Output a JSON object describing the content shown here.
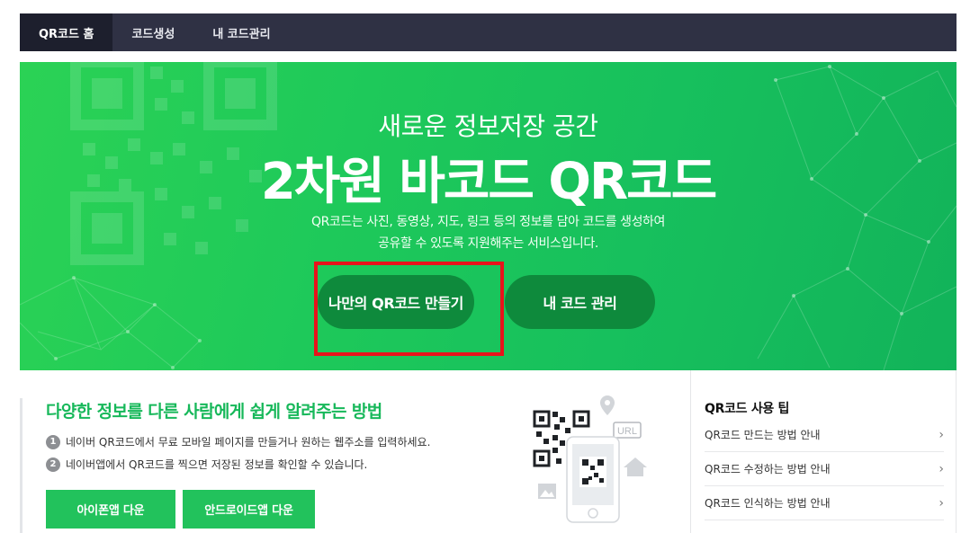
{
  "nav": {
    "tabs": [
      {
        "label": "QR코드 홈",
        "active": true
      },
      {
        "label": "코드생성",
        "active": false
      },
      {
        "label": "내 코드관리",
        "active": false
      }
    ]
  },
  "hero": {
    "subtitle": "새로운 정보저장 공간",
    "title": "2차원 바코드 QR코드",
    "desc_line1": "QR코드는 사진, 동영상, 지도, 링크 등의 정보를 담아 코드를 생성하여",
    "desc_line2": "공유할 수 있도록 지원해주는 서비스입니다.",
    "make_button": "나만의 QR코드 만들기",
    "manage_button": "내 코드 관리"
  },
  "info": {
    "title": "다양한 정보를 다른 사람에게 쉽게 알려주는 방법",
    "line1_num": "1",
    "line1": "네이버 QR코드에서 무료 모바일 페이지를 만들거나 원하는 웹주소를 입력하세요.",
    "line2_num": "2",
    "line2": "네이버앱에서 QR코드를 찍으면 저장된 정보를 확인할 수 있습니다.",
    "ios_button": "아이폰앱 다운",
    "android_button": "안드로이드앱 다운",
    "illust_url_label": "URL"
  },
  "tips": {
    "title": "QR코드 사용 팁",
    "items": [
      {
        "label": "QR코드 만드는 방법 안내",
        "chevron": "›"
      },
      {
        "label": "QR코드 수정하는 방법 안내",
        "chevron": "›"
      },
      {
        "label": "QR코드 인식하는 방법 안내",
        "chevron": "›"
      }
    ]
  },
  "colors": {
    "nav_bg": "#2f3144",
    "hero_green": "#1ec95a",
    "button_dark_green": "#0e8a3c",
    "accent_green": "#17b85a",
    "highlight_red": "#e8131b"
  }
}
